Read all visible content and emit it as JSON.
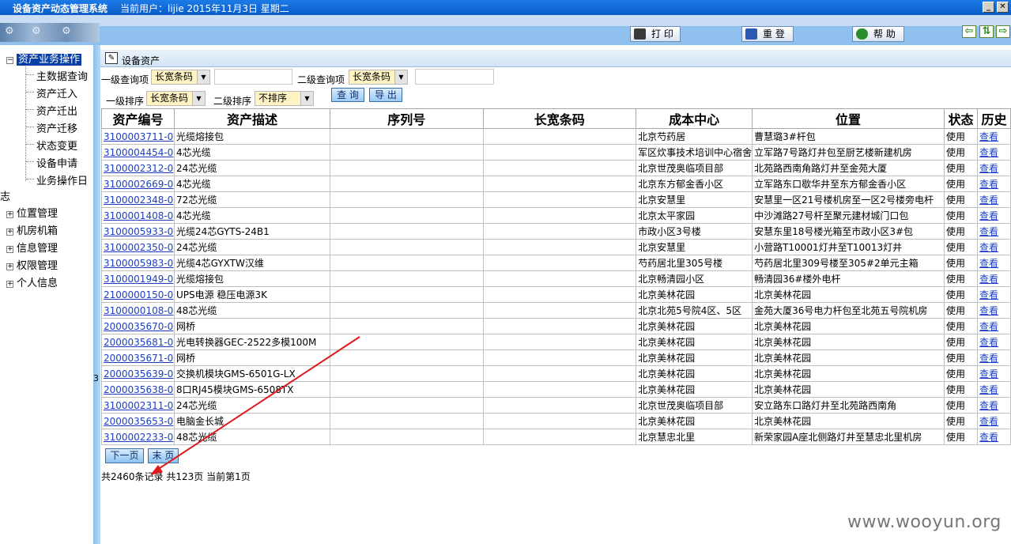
{
  "window": {
    "app_name": "设备资产动态管理系统",
    "user_info": "当前用户：lijie 2015年11月3日 星期二",
    "minimize_glyph": "_",
    "close_glyph": "✕"
  },
  "toolbar": {
    "print_label": "打 印",
    "relogin_label": "重 登",
    "help_label": "帮 助"
  },
  "sidebar": {
    "root_label": "资产业务操作",
    "children": [
      "主数据查询",
      "资产迁入",
      "资产迁出",
      "资产迁移",
      "状态变更",
      "设备申请",
      "业务操作日"
    ],
    "overflow_text": "志",
    "groups": [
      "位置管理",
      "机房机箱",
      "信息管理",
      "权限管理",
      "个人信息"
    ],
    "splitter_mark": "3"
  },
  "panel": {
    "title": "设备资产"
  },
  "query": {
    "level1_query_label": "一级查询项",
    "level1_query_value": "长宽条码",
    "level2_query_label": "二级查询项",
    "level2_query_value": "长宽条码",
    "level1_sort_label": "一级排序",
    "level1_sort_value": "长宽条码",
    "level2_sort_label": "二级排序",
    "level2_sort_value": "不排序",
    "search_label": "查 询",
    "export_label": "导 出"
  },
  "table": {
    "headers": [
      "资产编号",
      "资产描述",
      "序列号",
      "长宽条码",
      "成本中心",
      "位置",
      "状态",
      "历史"
    ],
    "rows": [
      [
        "3100003711-0",
        "光缆熔接包",
        "",
        "",
        "北京芍药居",
        "曹慧璐3#杆包",
        "使用",
        "查看"
      ],
      [
        "3100004454-0",
        "4芯光缆",
        "",
        "",
        "军区炊事技术培训中心宿舍",
        "立军路7号路灯井包至厨艺楼新建机房",
        "使用",
        "查看"
      ],
      [
        "3100002312-0",
        "24芯光缆",
        "",
        "",
        "北京世茂奥临项目部",
        "北苑路西南角路灯井至金苑大厦",
        "使用",
        "查看"
      ],
      [
        "3100002669-0",
        "4芯光缆",
        "",
        "",
        "北京东方郁金香小区",
        "立军路东口歇华井至东方郁金香小区",
        "使用",
        "查看"
      ],
      [
        "3100002348-0",
        "72芯光缆",
        "",
        "",
        "北京安慧里",
        "安慧里一区21号楼机房至一区2号楼旁电杆",
        "使用",
        "查看"
      ],
      [
        "3100001408-0",
        "4芯光缆",
        "",
        "",
        "北京太平家园",
        "中沙滩路27号杆至聚元建材城门口包",
        "使用",
        "查看"
      ],
      [
        "3100005933-0",
        "光缆24芯GYTS-24B1",
        "",
        "",
        "市政小区3号楼",
        "安慧东里18号楼光箱至市政小区3#包",
        "使用",
        "查看"
      ],
      [
        "3100002350-0",
        "24芯光缆",
        "",
        "",
        "北京安慧里",
        "小营路T10001灯井至T10013灯井",
        "使用",
        "查看"
      ],
      [
        "3100005983-0",
        "光缆4芯GYXTW汉维",
        "",
        "",
        "芍药居北里305号楼",
        "芍药居北里309号楼至305#2单元主箱",
        "使用",
        "查看"
      ],
      [
        "3100001949-0",
        "光缆熔接包",
        "",
        "",
        "北京畅清园小区",
        "畅清园36#楼外电杆",
        "使用",
        "查看"
      ],
      [
        "2100000150-0",
        "UPS电源 稳压电源3K",
        "",
        "",
        "北京美林花园",
        "北京美林花园",
        "使用",
        "查看"
      ],
      [
        "3100000108-0",
        "48芯光缆",
        "",
        "",
        "北京北苑5号院4区、5区",
        "金苑大厦36号电力杆包至北苑五号院机房",
        "使用",
        "查看"
      ],
      [
        "2000035670-0",
        "网桥",
        "",
        "",
        "北京美林花园",
        "北京美林花园",
        "使用",
        "查看"
      ],
      [
        "2000035681-0",
        "光电转换器GEC-2522多模100M",
        "",
        "",
        "北京美林花园",
        "北京美林花园",
        "使用",
        "查看"
      ],
      [
        "2000035671-0",
        "网桥",
        "",
        "",
        "北京美林花园",
        "北京美林花园",
        "使用",
        "查看"
      ],
      [
        "2000035639-0",
        "交换机模块GMS-6501G-LX",
        "",
        "",
        "北京美林花园",
        "北京美林花园",
        "使用",
        "查看"
      ],
      [
        "2000035638-0",
        "8口RJ45模块GMS-6508TX",
        "",
        "",
        "北京美林花园",
        "北京美林花园",
        "使用",
        "查看"
      ],
      [
        "3100002311-0",
        "24芯光缆",
        "",
        "",
        "北京世茂奥临项目部",
        "安立路东口路灯井至北苑路西南角",
        "使用",
        "查看"
      ],
      [
        "2000035653-0",
        "电脑金长城",
        "",
        "",
        "北京美林花园",
        "北京美林花园",
        "使用",
        "查看"
      ],
      [
        "3100002233-0",
        "48芯光缆",
        "",
        "",
        "北京慧忠北里",
        "新荣家园A座北侧路灯井至慧忠北里机房",
        "使用",
        "查看"
      ]
    ]
  },
  "pager": {
    "next_label": "下一页",
    "last_label": "末 页",
    "summary": "共2460条记录 共123页 当前第1页"
  },
  "watermark": "www.wooyun.org",
  "colors": {
    "title_bar": "#0a5cc8",
    "selected_node": "#0a3fa6",
    "link": "#1c3fc4",
    "annotation_arrow": "#e0191e"
  }
}
